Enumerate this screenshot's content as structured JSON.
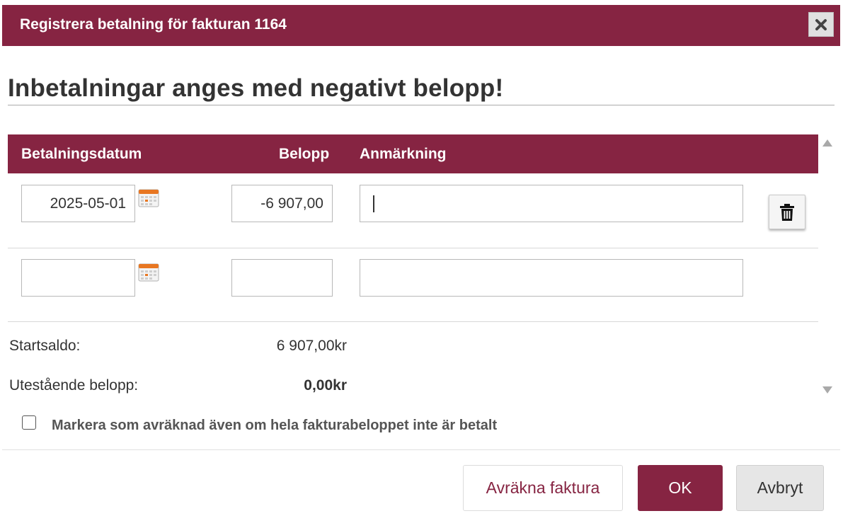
{
  "dialog": {
    "title": "Registrera betalning för fakturan 1164",
    "close_icon": "close-icon"
  },
  "heading": "Inbetalningar anges med negativt belopp!",
  "table": {
    "headers": {
      "date": "Betalningsdatum",
      "amount": "Belopp",
      "note": "Anmärkning"
    },
    "rows": [
      {
        "date": "2025-05-01",
        "amount": "-6 907,00",
        "note": ""
      },
      {
        "date": "",
        "amount": "",
        "note": ""
      }
    ],
    "calendar_icon": "calendar-icon",
    "delete_icon": "trash-icon"
  },
  "summary": {
    "start_label": "Startsaldo:",
    "start_value": "6 907,00kr",
    "outstanding_label": "Utestående belopp:",
    "outstanding_value": "0,00kr"
  },
  "settle_checkbox": {
    "label": "Markera som avräknad även om hela fakturabeloppet inte är betalt",
    "checked": false
  },
  "buttons": {
    "settle": "Avräkna faktura",
    "ok": "OK",
    "cancel": "Avbryt"
  },
  "colors": {
    "accent": "#862442",
    "calendar": "#e87722"
  }
}
